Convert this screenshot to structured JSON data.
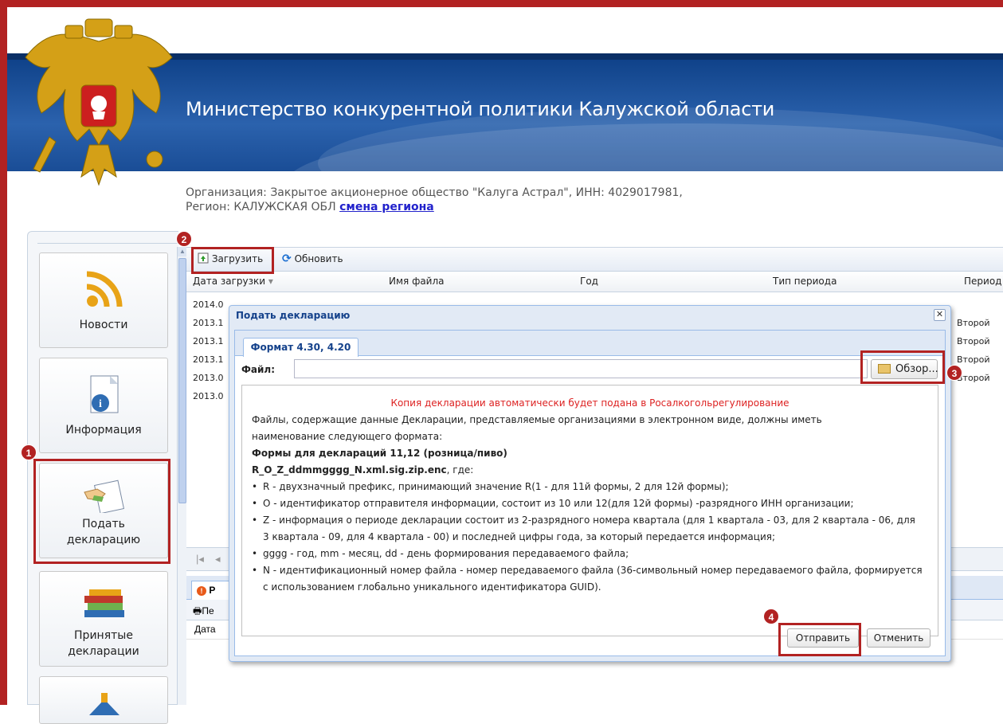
{
  "header": {
    "title": "Министерство конкурентной политики Калужской области",
    "org_line": "Организация: Закрытое акционерное общество \"Калуга Астрал\", ИНН: 4029017981,",
    "region_prefix": "Регион: КАЛУЖСКАЯ ОБЛ",
    "region_link": "смена региона"
  },
  "sidebar": {
    "items": [
      {
        "label": "Новости",
        "icon": "rss-icon"
      },
      {
        "label": "Информация",
        "icon": "info-document-icon"
      },
      {
        "label_line1": "Подать",
        "label_line2": "декларацию",
        "icon": "handshake-document-icon"
      },
      {
        "label_line1": "Принятые",
        "label_line2": "декларации",
        "icon": "books-icon"
      }
    ]
  },
  "toolbar": {
    "upload": "Загрузить",
    "refresh": "Обновить"
  },
  "grid": {
    "columns": [
      "Дата загрузки",
      "Имя файла",
      "Год",
      "Тип периода",
      "Период"
    ],
    "rows": [
      {
        "date": "2014.0",
        "period": ""
      },
      {
        "date": "2013.1",
        "period": "Второй"
      },
      {
        "date": "2013.1",
        "period": "Второй"
      },
      {
        "date": "2013.1",
        "period": "Второй"
      },
      {
        "date": "2013.0",
        "period": "Второй"
      },
      {
        "date": "2013.0",
        "period": ""
      }
    ],
    "lower_tab": "Р",
    "lower_toolbar": "Пе",
    "lower_header": "Дата"
  },
  "dialog": {
    "title": "Подать декларацию",
    "tab": "Формат 4.30, 4.20",
    "file_label": "Файл:",
    "browse": "Обзор...",
    "notice": "Копия декларации автоматически будет подана в Росалкогольрегулирование",
    "para1": "Файлы, содержащие данные Декларации, представляемые организациями в электронном виде, должны иметь",
    "para2": "наименование следующего формата:",
    "heading": "Формы для деклараций 11,12 (розница/пиво)",
    "format": "R_O_Z_ddmmgggg_N.xml.sig.zip.enc",
    "format_suffix": ", где:",
    "bullets": [
      "R - двухзначный префикс, принимающий значение R(1 - для 11й формы, 2 для 12й формы);",
      "O - идентификатор отправителя информации, состоит из 10 или 12(для 12й формы) -разрядного ИНН организации;",
      "Z - информация о периоде декларации состоит из 2-разрядного номера квартала (для 1 квартала - 03, для 2 квартала - 06, для 3 квартала - 09, для 4 квартала - 00) и последней цифры года, за который передается информация;",
      "gggg - год, mm - месяц, dd - день формирования передаваемого файла;",
      "N - идентификационный номер файла - номер передаваемого файла (36-символьный номер передаваемого файла, формируется с использованием глобально уникального идентификатора GUID)."
    ],
    "send": "Отправить",
    "cancel": "Отменить"
  },
  "callouts": [
    "1",
    "2",
    "3",
    "4"
  ],
  "colors": {
    "highlight": "#b22222",
    "banner": "#1a4d96",
    "notice": "#dd2222"
  }
}
